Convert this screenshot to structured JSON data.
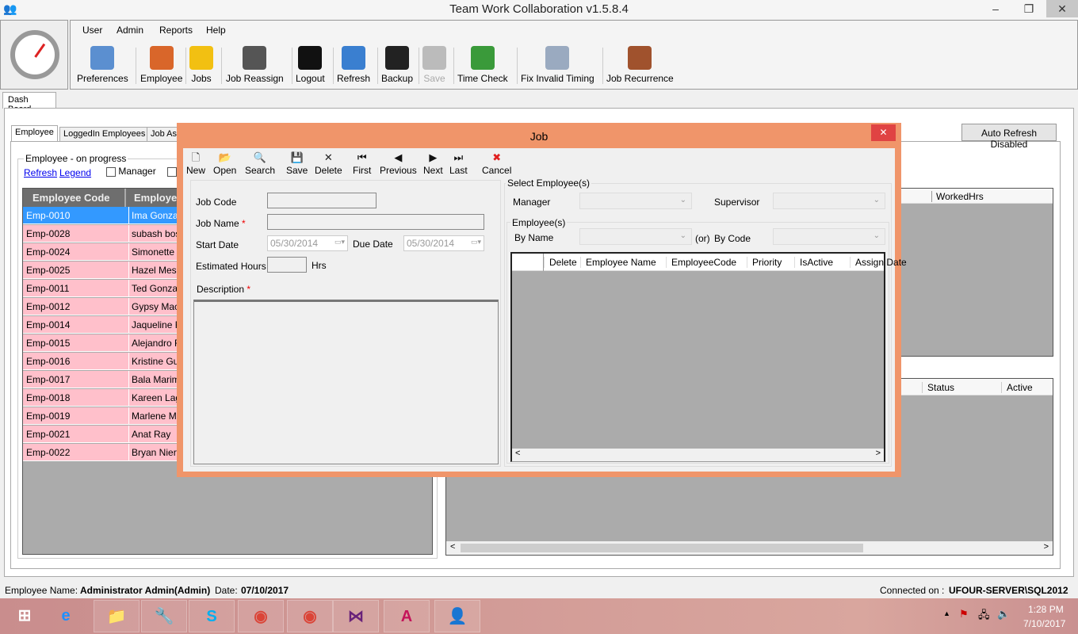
{
  "app": {
    "title": "Team Work Collaboration v1.5.8.4",
    "controls": {
      "minimize": "–",
      "restore": "❐",
      "close": "✕"
    }
  },
  "menu": [
    "User",
    "Admin",
    "Reports",
    "Help"
  ],
  "toolbar": [
    {
      "label": "Preferences",
      "icon": "preferences-icon",
      "color": "#5b8fd0"
    },
    {
      "label": "Employee",
      "icon": "employee-icon",
      "color": "#d9662a"
    },
    {
      "label": "Jobs",
      "icon": "hardhat-icon",
      "color": "#f2c012"
    },
    {
      "label": "Job Reassign",
      "icon": "job-reassign-icon",
      "color": "#555555"
    },
    {
      "label": "Logout",
      "icon": "power-icon",
      "color": "#111111"
    },
    {
      "label": "Refresh",
      "icon": "refresh-icon",
      "color": "#3a7fd0"
    },
    {
      "label": "Backup",
      "icon": "database-icon",
      "color": "#222222"
    },
    {
      "label": "Save",
      "icon": "save-icon",
      "color": "#bbbbbb",
      "disabled": true
    },
    {
      "label": "Time Check",
      "icon": "calendar-clock-icon",
      "color": "#3a9a3a"
    },
    {
      "label": "Fix Invalid Timing",
      "icon": "documents-icon",
      "color": "#9aaac0"
    },
    {
      "label": "Job Recurrence",
      "icon": "briefcase-icon",
      "color": "#a0522d"
    }
  ],
  "dashtab": "Dash Board",
  "inner_tabs": [
    "Employee",
    "LoggedIn Employees",
    "Job As"
  ],
  "auto_refresh": "Auto Refresh Disabled",
  "employee_group": {
    "title": "Employee - on progress",
    "refresh": "Refresh",
    "legend": "Legend",
    "manager": "Manager",
    "columns": [
      "Employee Code",
      "Employee"
    ],
    "rows": [
      [
        "Emp-0010",
        "Ima  Gonzale"
      ],
      [
        "Emp-0028",
        "subash  bose"
      ],
      [
        "Emp-0024",
        "Simonette  R"
      ],
      [
        "Emp-0025",
        "Hazel  Messi"
      ],
      [
        "Emp-0011",
        "Ted  Gonzale"
      ],
      [
        "Emp-0012",
        "Gypsy  Mace"
      ],
      [
        "Emp-0014",
        "Jaqueline  Ro"
      ],
      [
        "Emp-0015",
        "Alejandro  Ro"
      ],
      [
        "Emp-0016",
        "Kristine  Gutie"
      ],
      [
        "Emp-0017",
        "Bala  Marimut"
      ],
      [
        "Emp-0018",
        "Kareen  Lagr"
      ],
      [
        "Emp-0019",
        "Marlene  Ma"
      ],
      [
        "Emp-0021",
        "Anat  Ray"
      ],
      [
        "Emp-0022",
        "Bryan  Nierve"
      ]
    ]
  },
  "right_grid1": {
    "columns": [
      "WorkedHrs"
    ]
  },
  "right_grid2": {
    "columns": [
      "Status",
      "Active"
    ]
  },
  "dialog": {
    "title": "Job",
    "close": "✕",
    "toolbar": [
      {
        "label": "New",
        "glyph": "🗋"
      },
      {
        "label": "Open",
        "glyph": "📂"
      },
      {
        "label": "Search",
        "glyph": "🔍"
      },
      {
        "label": "Save",
        "glyph": "💾"
      },
      {
        "label": "Delete",
        "glyph": "✕"
      },
      {
        "label": "First",
        "glyph": "⏮"
      },
      {
        "label": "Previous",
        "glyph": "◀"
      },
      {
        "label": "Next",
        "glyph": "▶"
      },
      {
        "label": "Last",
        "glyph": "⏭"
      },
      {
        "label": "Cancel",
        "glyph": "✖"
      }
    ],
    "job_code": "Job Code",
    "job_name": "Job Name",
    "start_date": "Start Date",
    "start_value": "05/30/2014",
    "due_date": "Due Date",
    "due_value": "05/30/2014",
    "est_hours": "Estimated Hours",
    "hrs": "Hrs",
    "description": "Description",
    "required": "*",
    "select_group": "Select Employee(s)",
    "manager": "Manager",
    "supervisor": "Supervisor",
    "employees_group": "Employee(s)",
    "by_name": "By Name",
    "or": "(or)",
    "by_code": "By Code",
    "grid_columns": [
      "Delete",
      "Employee Name",
      "EmployeeCode",
      "Priority",
      "IsActive",
      "Assign Date"
    ]
  },
  "status": {
    "name_label": "Employee Name:",
    "name": "Administrator  Admin(Admin)",
    "date_label": "Date:",
    "date": "07/10/2017",
    "conn_label": "Connected on :",
    "conn": "UFOUR-SERVER\\SQL2012"
  },
  "taskbar": {
    "apps": [
      "windows-start-icon",
      "internet-explorer-icon",
      "file-explorer-icon",
      "tools-icon",
      "skype-icon",
      "chrome-icon",
      "chrome-icon",
      "visual-studio-icon",
      "access-icon",
      "team-work-icon"
    ],
    "time": "1:28 PM",
    "date": "7/10/2017"
  }
}
